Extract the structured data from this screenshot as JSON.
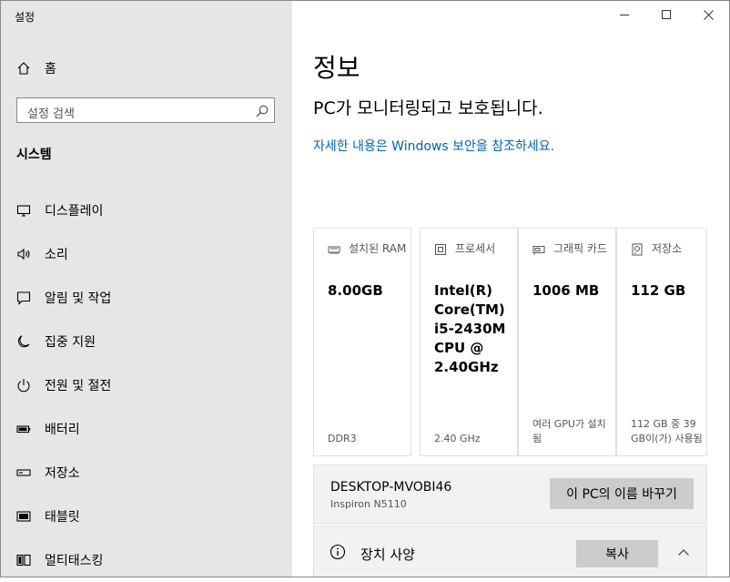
{
  "window": {
    "title": "설정"
  },
  "sidebar": {
    "home_label": "홈",
    "search_placeholder": "설정 검색",
    "section_label": "시스템",
    "items": [
      {
        "label": "디스플레이",
        "icon": "monitor-icon"
      },
      {
        "label": "소리",
        "icon": "speaker-icon"
      },
      {
        "label": "알림 및 작업",
        "icon": "notification-icon"
      },
      {
        "label": "집중 지원",
        "icon": "moon-icon"
      },
      {
        "label": "전원 및 절전",
        "icon": "power-icon"
      },
      {
        "label": "배터리",
        "icon": "battery-icon"
      },
      {
        "label": "저장소",
        "icon": "storage-icon"
      },
      {
        "label": "태블릿",
        "icon": "tablet-icon"
      },
      {
        "label": "멀티태스킹",
        "icon": "multitasking-icon"
      }
    ]
  },
  "main": {
    "title": "정보",
    "status": "PC가 모니터링되고 보호됩니다.",
    "link": "자세한 내용은 Windows 보안을 참조하세요.",
    "cards": [
      {
        "header": "설치된 RAM",
        "value": "8.00GB",
        "footer": "DDR3",
        "icon": "ram-icon"
      },
      {
        "header": "프로세서",
        "value": "Intel(R) Core(TM) i5-2430M CPU @ 2.40GHz",
        "footer": "2.40 GHz",
        "icon": "processor-icon"
      },
      {
        "header": "그래픽 카드",
        "value": "1006 MB",
        "footer": "여러 GPU가 설치됨",
        "icon": "graphics-card-icon"
      },
      {
        "header": "저장소",
        "value": "112 GB",
        "footer": "112 GB 중 39 GB이(가) 사용됨",
        "icon": "storage-icon"
      }
    ],
    "device_name": "DESKTOP-MVOBI46",
    "device_model": "Inspiron N5110",
    "rename_button": "이 PC의 이름 바꾸기",
    "specs_label": "장치 사양",
    "copy_button": "복사"
  },
  "colors": {
    "sidebar_bg": "#e6e6e6",
    "link": "#0063b1",
    "button_bg": "#cccccc"
  }
}
